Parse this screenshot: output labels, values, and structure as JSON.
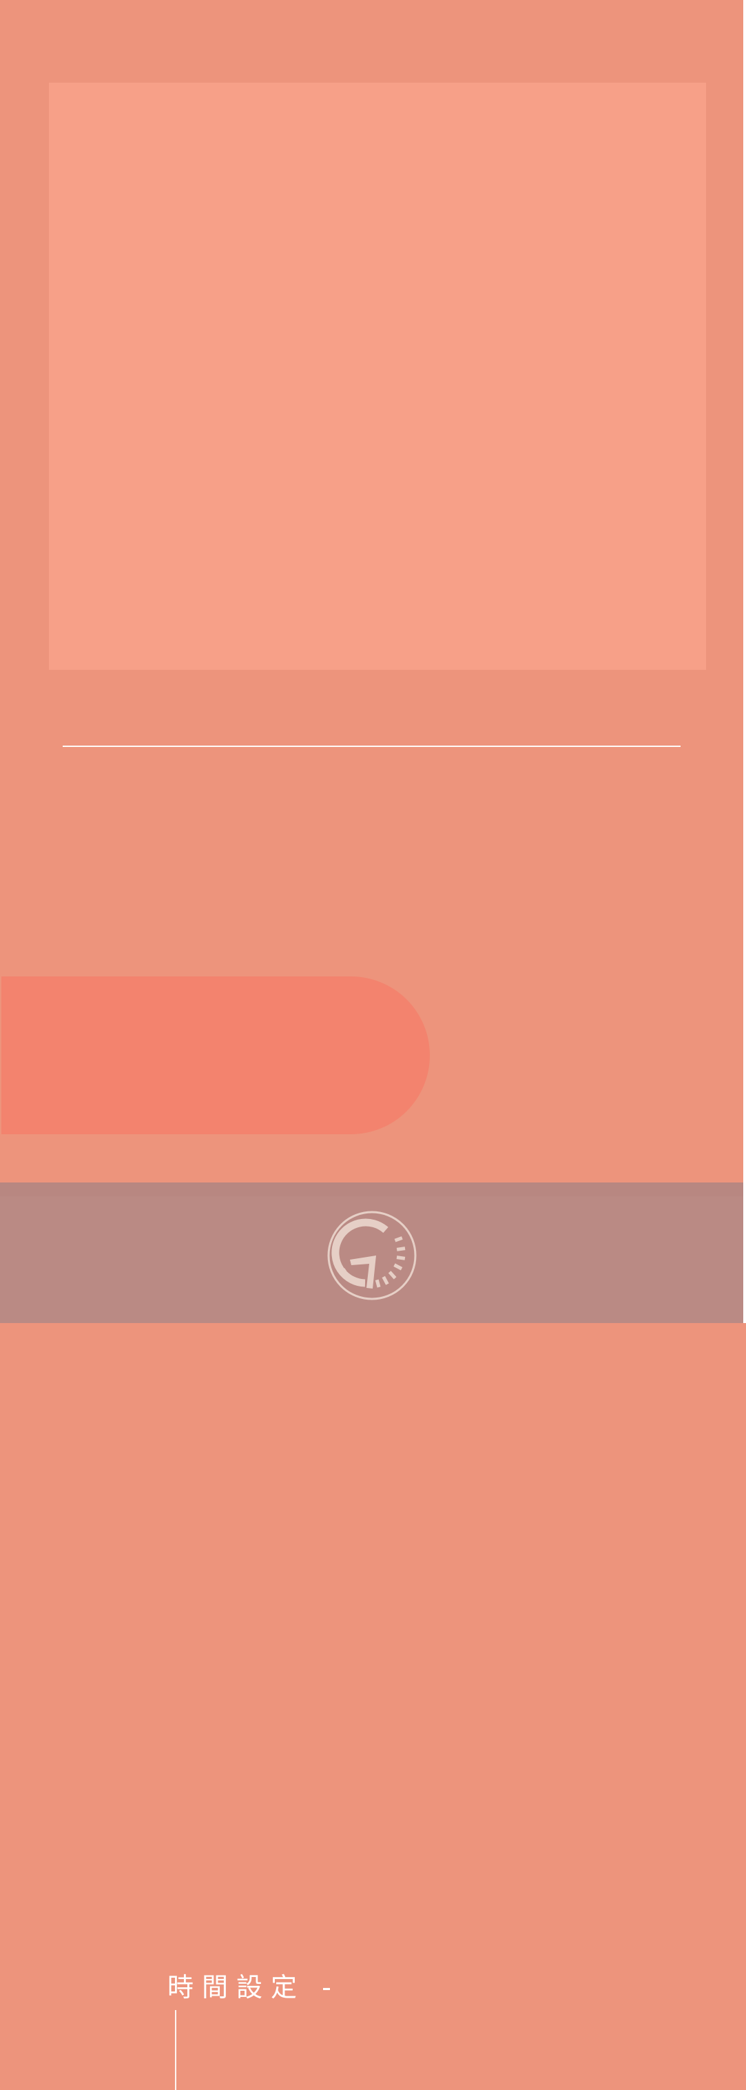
{
  "time_setting": {
    "label": "時間設定 -",
    "value": ""
  },
  "footer": {
    "logo_icon": "clock-logo-icon"
  },
  "colors": {
    "background": "#ED947C",
    "panel": "#F7A088",
    "time_pill": "#F3836E",
    "footer": "#BA8A84",
    "logo": "#E6CFC6"
  }
}
